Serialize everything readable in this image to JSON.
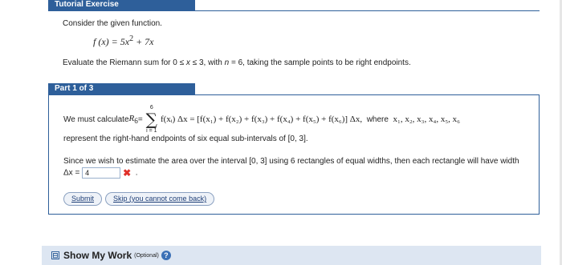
{
  "tutorial": {
    "tab_title": "Tutorial Exercise",
    "intro": "Consider the given function.",
    "function": {
      "lhs": "f (x) = 5x",
      "exp": "2",
      "rhs": " + 7x"
    },
    "evaluate": {
      "before": "Evaluate the Riemann sum for 0 ≤ ",
      "var1": "x",
      "mid": " ≤ 3, with ",
      "var2": "n",
      "after": " = 6, taking the sample points to be right endpoints."
    }
  },
  "part": {
    "tab_title": "Part 1 of 3",
    "calc": {
      "prefix": "We must calculate ",
      "r6": "R",
      "r6_sub": "6",
      "equals": " = ",
      "sum_top": "6",
      "sum_bottom": "i = 1",
      "sigma": "∑",
      "expr": "f(xᵢ) Δx = [f(x₁) + f(x₂) + f(x₃) + f(x₄) + f(x₅) + f(x₆)] Δx,",
      "where": "  where  ",
      "points": "x₁, x₂, x₃, x₄, x₅, x₆"
    },
    "represent": "represent the right-hand endpoints of six equal sub-intervals of  [0, 3].",
    "since": "Since we wish to estimate the area over the interval  [0, 3]  using 6 rectangles of equal widths, then each rectangle will have width  Δx = ",
    "answer_value": "4",
    "wrong_mark": "✖",
    "period": "  .",
    "buttons": {
      "submit": "Submit",
      "skip": "Skip (you cannot come back)"
    }
  },
  "showwork": {
    "expander": "⊟",
    "label": "Show My Work",
    "optional": "(Optional)",
    "help": "?"
  }
}
